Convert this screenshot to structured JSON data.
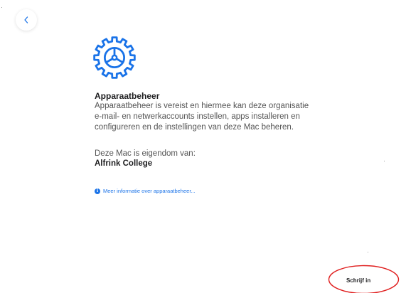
{
  "back_button": {
    "icon": "chevron-left-icon"
  },
  "header_icon": "gear-icon",
  "device_management": {
    "heading": "Apparaatbeheer",
    "description_lines": [
      "Apparaatbeheer is vereist en hiermee kan deze organisatie",
      "e-mail- en netwerkaccounts instellen, apps installeren en",
      "configureren en de instellingen van deze Mac beheren."
    ]
  },
  "ownership": {
    "label": "Deze Mac is eigendom van:",
    "owner": "Alfrink College"
  },
  "info_link": {
    "icon": "info-icon",
    "text": "Meer informatie over apparaatbeheer..."
  },
  "signin_button": {
    "label": "Schrijf in"
  },
  "colors": {
    "accent": "#1a73e8",
    "annotation": "#e02020"
  }
}
